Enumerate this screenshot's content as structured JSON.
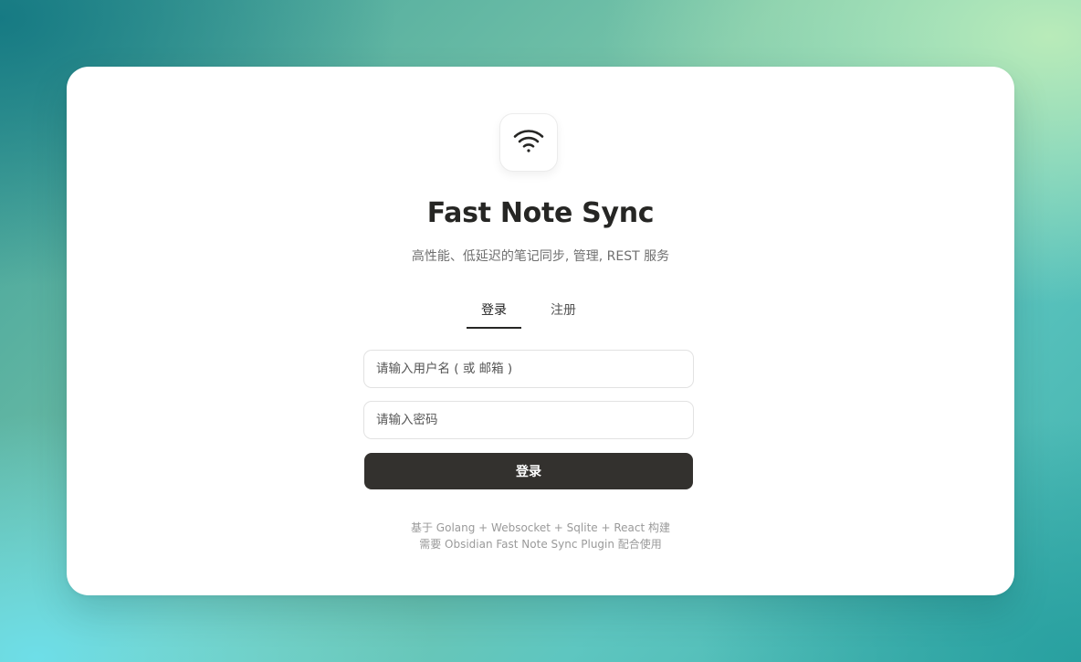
{
  "app": {
    "title": "Fast Note Sync",
    "subtitle": "高性能、低延迟的笔记同步, 管理, REST 服务",
    "logo_icon": "wifi-icon"
  },
  "tabs": [
    {
      "label": "登录",
      "active": true
    },
    {
      "label": "注册",
      "active": false
    }
  ],
  "form": {
    "username_placeholder": "请输入用户名 ( 或 邮箱 )",
    "username_value": "",
    "password_placeholder": "请输入密码",
    "password_value": "",
    "submit_label": "登录"
  },
  "footer": {
    "line1": "基于 Golang + Websocket + Sqlite + React 构建",
    "line2": "需要 Obsidian Fast Note Sync Plugin 配合使用"
  },
  "colors": {
    "primary_button": "#33312e",
    "title_text": "#262624",
    "card_background": "#ffffff"
  }
}
